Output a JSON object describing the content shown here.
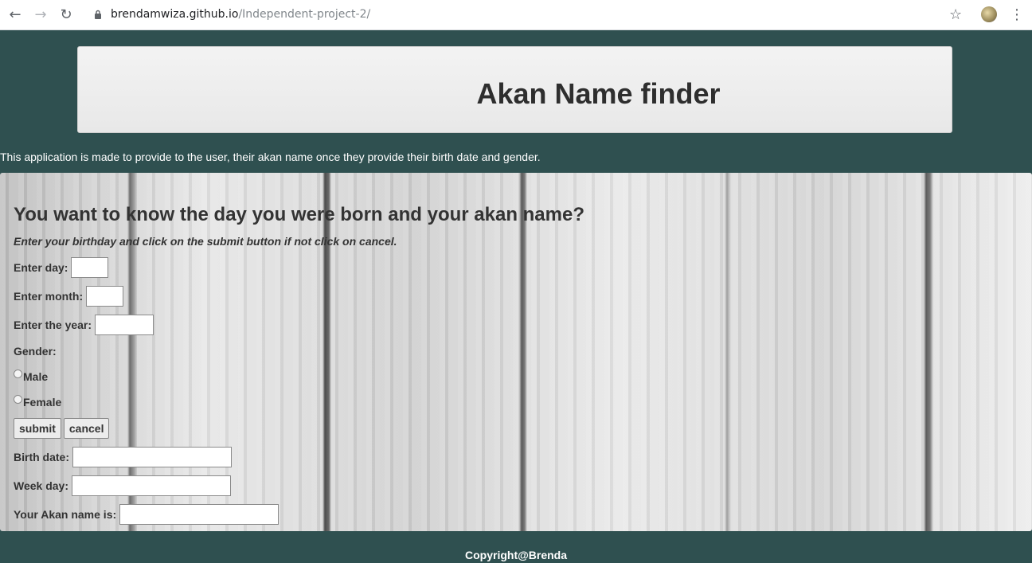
{
  "browser": {
    "url_domain": "brendamwiza.github.io",
    "url_path": "/Independent-project-2/",
    "back_icon": "arrow-left",
    "forward_icon": "arrow-right",
    "reload_icon": "reload",
    "bookmark_icon": "star",
    "menu_icon": "kebab"
  },
  "header": {
    "title": "Akan Name finder"
  },
  "intro": "This application is made to provide to the user, their akan name once they provide their birth date and gender.",
  "form": {
    "heading": "You want to know the day you were born and your akan name?",
    "instructions": "Enter your birthday and click on the submit button if not click on cancel.",
    "day_label": "Enter day:",
    "month_label": "Enter month:",
    "year_label": "Enter the year:",
    "gender_label": "Gender:",
    "male_label": "Male",
    "female_label": "Female",
    "submit_label": "submit",
    "cancel_label": "cancel",
    "birthdate_label": "Birth date:",
    "weekday_label": "Week day:",
    "akan_label": "Your Akan name is:"
  },
  "footer": "Copyright@Brenda",
  "colors": {
    "page_bg": "#2f5050",
    "header_bg": "#eeeeee",
    "title_color": "#2e2e2e"
  }
}
